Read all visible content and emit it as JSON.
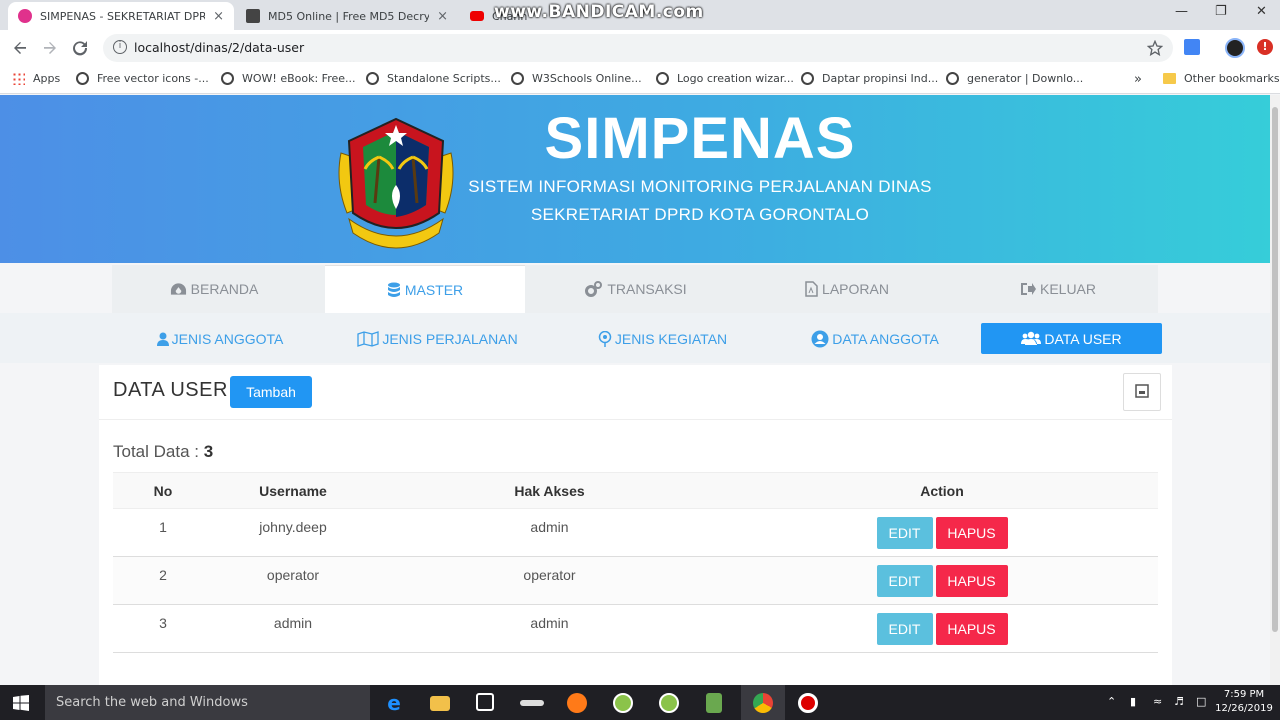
{
  "browser": {
    "tabs": [
      {
        "title": "SIMPENAS - SEKRETARIAT DPRD",
        "close": "×"
      },
      {
        "title": "MD5 Online | Free MD5 Decryptio",
        "close": "×"
      },
      {
        "title": "Chann",
        "close": ""
      }
    ],
    "watermark": "www.BANDICAM.com",
    "url": "localhost/dinas/2/data-user",
    "bookmarks": [
      "Apps",
      "Free vector icons -...",
      "WOW! eBook: Free...",
      "Standalone Scripts...",
      "W3Schools Online...",
      "Logo creation wizar...",
      "Daptar propinsi Ind...",
      "generator | Downlo..."
    ],
    "overflow": "»",
    "other_bookmarks": "Other bookmarks"
  },
  "header": {
    "title": "SIMPENAS",
    "subtitle1": "SISTEM INFORMASI MONITORING PERJALANAN DINAS",
    "subtitle2": "SEKRETARIAT DPRD KOTA GORONTALO",
    "logo_text": "KOTA GORONTALO"
  },
  "mainnav": [
    {
      "label": "BERANDA",
      "icon": "dashboard-icon"
    },
    {
      "label": "MASTER",
      "icon": "database-icon"
    },
    {
      "label": "TRANSAKSI",
      "icon": "cogs-icon"
    },
    {
      "label": "LAPORAN",
      "icon": "file-pdf-icon"
    },
    {
      "label": "KELUAR",
      "icon": "sign-out-icon"
    }
  ],
  "subnav": [
    {
      "label": "JENIS ANGGOTA",
      "icon": "user-icon"
    },
    {
      "label": "JENIS PERJALANAN",
      "icon": "map-icon"
    },
    {
      "label": "JENIS KEGIATAN",
      "icon": "map-pin-icon"
    },
    {
      "label": "DATA ANGGOTA",
      "icon": "user-circle-icon"
    },
    {
      "label": "DATA USER",
      "icon": "users-icon"
    }
  ],
  "card": {
    "title": "DATA USER",
    "add_button": "Tambah",
    "total_label": "Total Data : ",
    "total_value": "3"
  },
  "table": {
    "headers": [
      "No",
      "Username",
      "Hak Akses",
      "Action"
    ],
    "rows": [
      {
        "no": "1",
        "username": "johny.deep",
        "hak_akses": "admin"
      },
      {
        "no": "2",
        "username": "operator",
        "hak_akses": "operator"
      },
      {
        "no": "3",
        "username": "admin",
        "hak_akses": "admin"
      }
    ],
    "edit_label": "EDIT",
    "delete_label": "HAPUS"
  },
  "taskbar": {
    "search_placeholder": "Search the web and Windows",
    "time": "7:59 PM",
    "date": "12/26/2019"
  },
  "colors": {
    "accent": "#2196f3",
    "edit": "#5bc0de",
    "delete": "#f5284a",
    "header_start": "#4d8fe6",
    "header_end": "#36cdd9"
  }
}
